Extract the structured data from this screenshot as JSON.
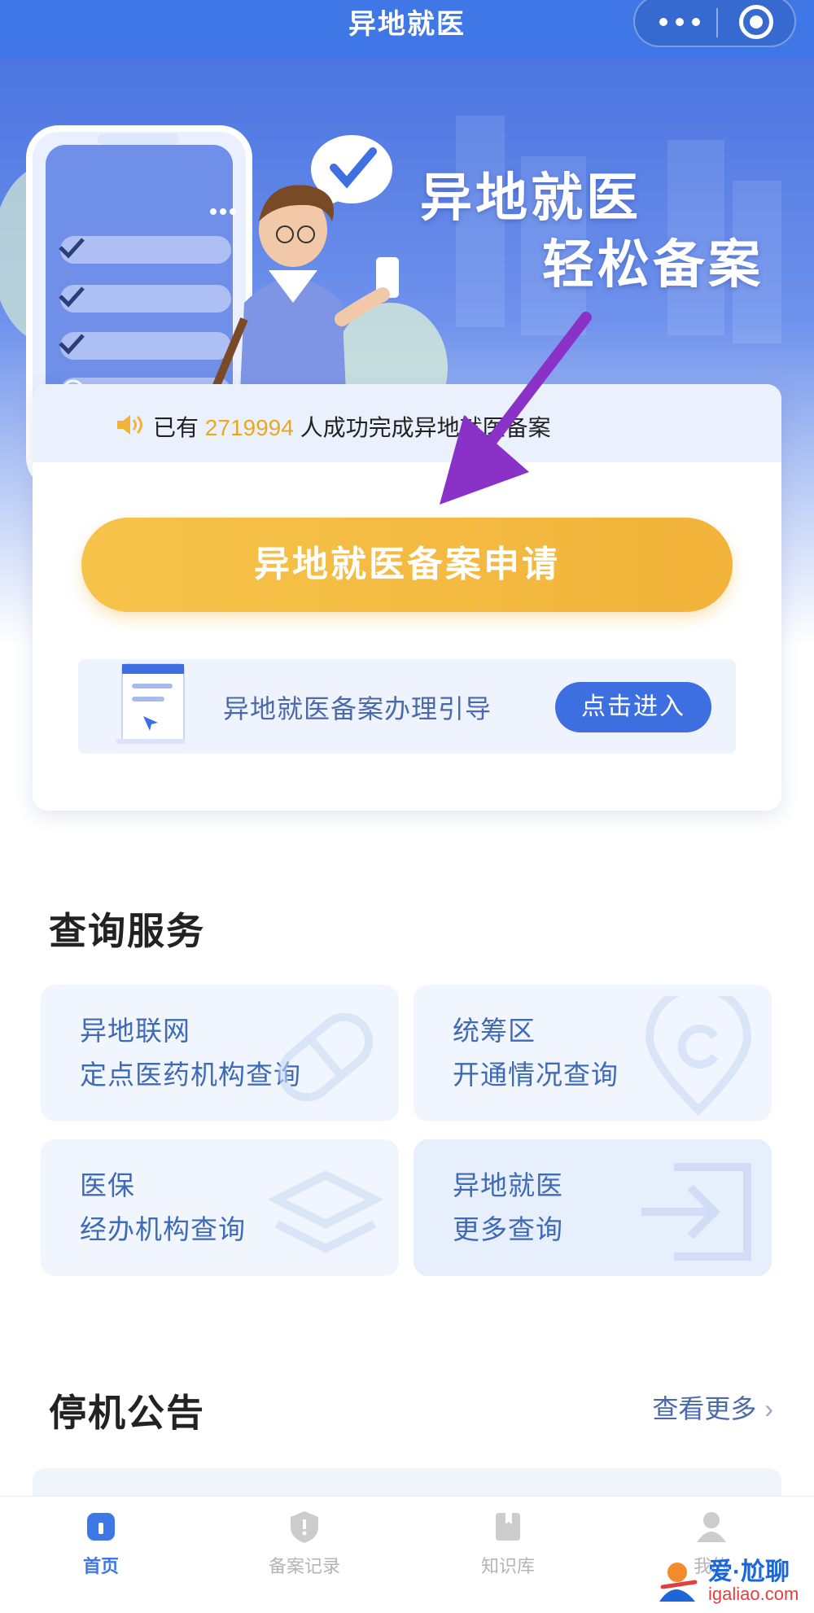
{
  "navbar": {
    "title": "异地就医"
  },
  "hero": {
    "line1": "异地就医",
    "line2": "轻松备案"
  },
  "ticker": {
    "prefix": "已有",
    "count": "2719994",
    "suffix": "人成功完成异地就医备案"
  },
  "apply_button": "异地就医备案申请",
  "guide": {
    "label": "异地就医备案办理引导",
    "button": "点击进入"
  },
  "query_section": {
    "title": "查询服务",
    "tiles": [
      {
        "line1": "异地联网",
        "line2": "定点医药机构查询",
        "icon": "pill-icon"
      },
      {
        "line1": "统筹区",
        "line2": "开通情况查询",
        "icon": "location-pin-icon"
      },
      {
        "line1": "医保",
        "line2": "经办机构查询",
        "icon": "layers-icon"
      },
      {
        "line1": "异地就医",
        "line2": "更多查询",
        "icon": "enter-icon"
      }
    ]
  },
  "notice_section": {
    "title": "停机公告",
    "more": "查看更多"
  },
  "tabbar": {
    "items": [
      {
        "label": "首页",
        "icon": "home-icon",
        "active": true
      },
      {
        "label": "备案记录",
        "icon": "shield-icon",
        "active": false
      },
      {
        "label": "知识库",
        "icon": "book-icon",
        "active": false
      },
      {
        "label": "我的",
        "icon": "user-icon",
        "active": false
      }
    ]
  },
  "watermark": {
    "brand": "爱·尬聊",
    "url": "igaliao.com"
  },
  "colors": {
    "primary": "#3f78e6",
    "accent_yellow": "#f4bb42",
    "ticker_number": "#e9a81e",
    "tile_text": "#3e6ab6"
  }
}
